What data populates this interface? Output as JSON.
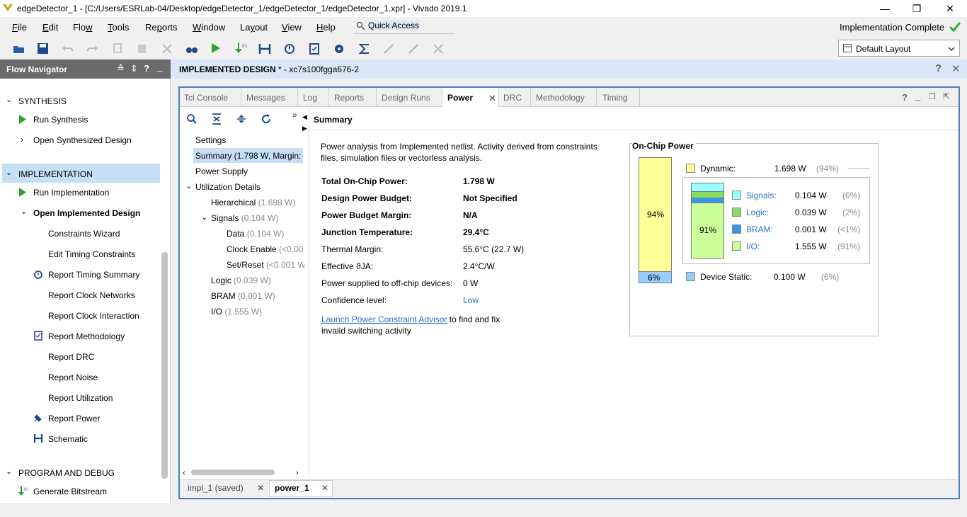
{
  "window": {
    "title": "edgeDetector_1 - [C:/Users/ESRLab-04/Desktop/edgeDetector_1/edgeDetector_1/edgeDetector_1.xpr] - Vivado 2019.1"
  },
  "menu": [
    {
      "label": "File",
      "key": "F"
    },
    {
      "label": "Edit",
      "key": "E"
    },
    {
      "label": "Flow",
      "key": "w"
    },
    {
      "label": "Tools",
      "key": "T"
    },
    {
      "label": "Reports",
      "key": "p"
    },
    {
      "label": "Window",
      "key": "W"
    },
    {
      "label": "Layout",
      "key": "y"
    },
    {
      "label": "View",
      "key": "V"
    },
    {
      "label": "Help",
      "key": "H"
    }
  ],
  "quick_access": "Quick Access",
  "status": "Implementation Complete",
  "layout_select": "Default Layout",
  "flow_navigator": {
    "title": "Flow Navigator",
    "synthesis": {
      "label": "SYNTHESIS",
      "run": "Run Synthesis",
      "open": "Open Synthesized Design"
    },
    "implementation": {
      "label": "IMPLEMENTATION",
      "run": "Run Implementation",
      "open": "Open Implemented Design"
    },
    "impl_items": [
      "Constraints Wizard",
      "Edit Timing Constraints",
      "Report Timing Summary",
      "Report Clock Networks",
      "Report Clock Interaction",
      "Report Methodology",
      "Report DRC",
      "Report Noise",
      "Report Utilization",
      "Report Power",
      "Schematic"
    ],
    "program": {
      "label": "PROGRAM AND DEBUG",
      "gen": "Generate Bitstream"
    }
  },
  "design_header": {
    "name": "IMPLEMENTED DESIGN",
    "suffix": " * - xc7s100fgga676-2"
  },
  "tabs": [
    "Tcl Console",
    "Messages",
    "Log",
    "Reports",
    "Design Runs",
    "Power",
    "DRC",
    "Methodology",
    "Timing"
  ],
  "active_tab": "Power",
  "tree": {
    "settings": "Settings",
    "summary": "Summary (1.798 W, Margin:",
    "power_supply": "Power Supply",
    "util": "Utilization Details",
    "hier": "Hierarchical",
    "hier_v": " (1.698 W)",
    "signals": "Signals",
    "signals_v": " (0.104 W)",
    "data": "Data",
    "data_v": " (0.104 W)",
    "clk": "Clock Enable",
    "clk_v": " (<0.00",
    "setreset": "Set/Reset",
    "setreset_v": " (<0.001 W",
    "logic": "Logic",
    "logic_v": " (0.039 W)",
    "bram": "BRAM",
    "bram_v": " (0.001 W)",
    "io": "I/O",
    "io_v": " (1.555 W)"
  },
  "summary": {
    "title": "Summary",
    "intro1": "Power analysis from Implemented netlist. Activity derived from constraints",
    "intro2": "files, simulation files or vectorless analysis.",
    "rows": [
      {
        "k": "Total On-Chip Power:",
        "v": "1.798 W",
        "bold": true
      },
      {
        "k": "Design Power Budget:",
        "v": "Not Specified",
        "bold": true
      },
      {
        "k": "Power Budget Margin:",
        "v": "N/A",
        "bold": true
      },
      {
        "k": "Junction Temperature:",
        "v": "29.4°C",
        "bold": true
      },
      {
        "k": "Thermal Margin:",
        "v": "55.6°C (22.7 W)",
        "bold": false
      },
      {
        "k": "Effective ϑJA:",
        "v": "2.4°C/W",
        "bold": false
      },
      {
        "k": "Power supplied to off-chip devices:",
        "v": "0 W",
        "bold": false
      },
      {
        "k": "Confidence level:",
        "v": "Low",
        "bold": false
      }
    ],
    "link": "Launch Power Constraint Advisor",
    "link_rest1": " to find and fix",
    "link_rest2": "invalid switching activity"
  },
  "on_chip": {
    "title": "On-Chip Power",
    "dynamic": {
      "label": "Dynamic:",
      "value": "1.698 W",
      "pct": "(94%)",
      "frac": 0.94,
      "color": "#ffff99"
    },
    "static": {
      "label": "Device Static:",
      "value": "0.100 W",
      "pct": "(6%)",
      "frac": 0.06,
      "color": "#99ccff"
    },
    "bar_dyn_label": "94%",
    "bar_static_label": "6%",
    "inner_label": "91%",
    "parts": [
      {
        "label": "Signals:",
        "value": "0.104 W",
        "pct": "(6%)",
        "frac": 0.06,
        "color": "#99ffff"
      },
      {
        "label": "Logic:",
        "value": "0.039 W",
        "pct": "(2%)",
        "frac": 0.02,
        "color": "#88dd66"
      },
      {
        "label": "BRAM:",
        "value": "0.001 W",
        "pct": "(<1%)",
        "frac": 0.01,
        "color": "#3399ee"
      },
      {
        "label": "I/O:",
        "value": "1.555 W",
        "pct": "(91%)",
        "frac": 0.91,
        "color": "#ccff99"
      }
    ]
  },
  "bottom_tabs": [
    {
      "label": "impl_1 (saved)",
      "active": false
    },
    {
      "label": "power_1",
      "active": true
    }
  ]
}
